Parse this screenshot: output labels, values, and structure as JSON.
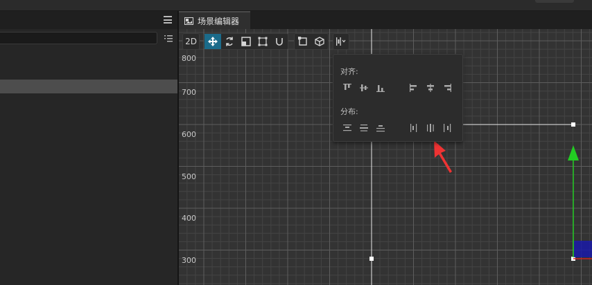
{
  "scene_panel": {
    "tab_title": "场景编辑器",
    "tab_icon": "scene-image-icon",
    "toolbar": {
      "mode_2d_label": "2D",
      "tools": [
        "move-tool-icon",
        "rotate-tool-icon",
        "scale-tool-icon",
        "rect-tool-icon",
        "magnet-snap-icon"
      ],
      "extra_tools": [
        "anchor-rect-icon",
        "cube-3d-icon"
      ],
      "align_menu": "align-distribute-icon",
      "active_tool": "move-tool-icon"
    },
    "align_popup": {
      "align_title": "对齐:",
      "distribute_title": "分布:",
      "align_icons": [
        "align-top-icon",
        "align-vcenter-icon",
        "align-bottom-icon",
        "align-left-icon",
        "align-hcenter-icon",
        "align-right-icon"
      ],
      "distribute_icons": [
        "distribute-top-icon",
        "distribute-vcenter-icon",
        "distribute-bottom-icon",
        "distribute-left-icon",
        "distribute-hcenter-icon",
        "distribute-right-icon"
      ]
    },
    "y_axis_labels": [
      "800",
      "700",
      "600",
      "500",
      "400",
      "300"
    ],
    "colors": {
      "active_tool": "#1b6b8a",
      "grid_major": "#5a5a5a",
      "gizmo_y": "#22cc22",
      "gizmo_x": "#cc2222",
      "gizmo_box": "#1a1aa8",
      "arrow": "#ee3333"
    }
  },
  "hierarchy_panel": {
    "menu_icon": "hamburger-menu-icon",
    "search_placeholder": "",
    "sort_icon": "sort-list-icon"
  }
}
